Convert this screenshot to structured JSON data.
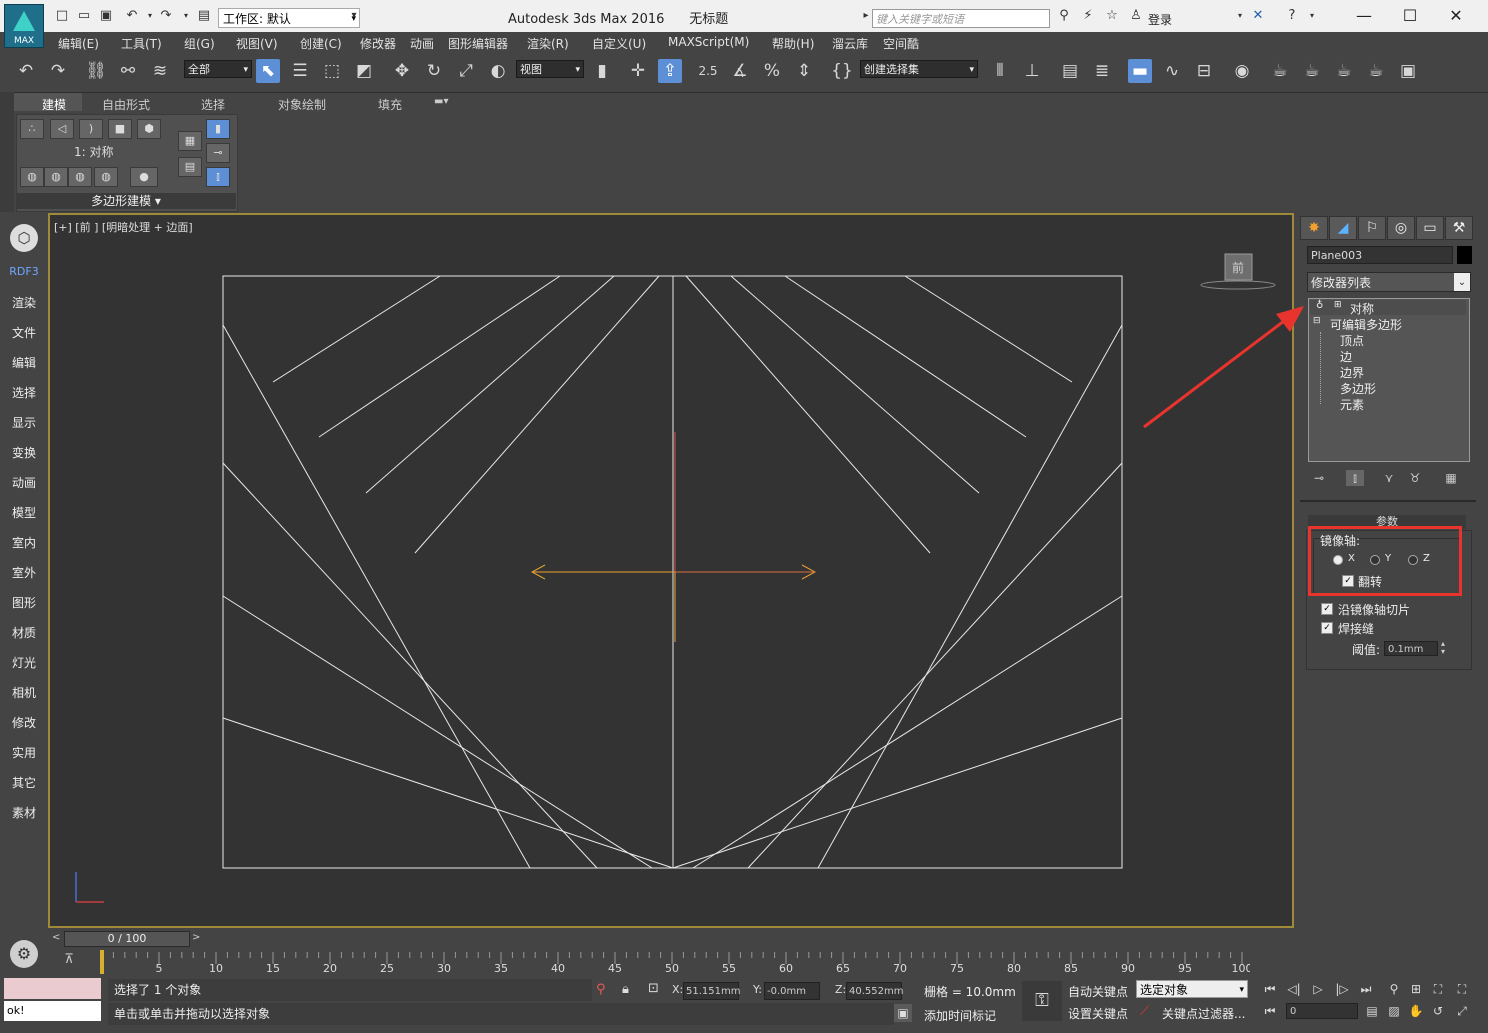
{
  "app": {
    "title": "Autodesk 3ds Max 2016",
    "document": "无标题",
    "logo_text": "MAX",
    "workspace_label": "工作区: 默认",
    "search_placeholder": "键入关键字或短语",
    "login": "登录"
  },
  "menu": [
    "编辑(E)",
    "工具(T)",
    "组(G)",
    "视图(V)",
    "创建(C)",
    "修改器",
    "动画",
    "图形编辑器",
    "渲染(R)",
    "自定义(U)",
    "MAXScript(M)",
    "帮助(H)",
    "溜云库",
    "空间酷"
  ],
  "toolbar": {
    "filter_value": "全部",
    "refcoord_value": "视图",
    "snap_label": "2.5",
    "named_selection_value": "创建选择集"
  },
  "ribbon": {
    "tabs": [
      "建模",
      "自由形式",
      "选择",
      "对象绘制",
      "填充"
    ],
    "stack_label": "1: 对称",
    "panel_label": "多边形建模"
  },
  "sidebar": {
    "top_label": "RDF3",
    "items": [
      "渲染",
      "文件",
      "编辑",
      "选择",
      "显示",
      "变换",
      "动画",
      "模型",
      "室内",
      "室外",
      "图形",
      "材质",
      "灯光",
      "相机",
      "修改",
      "实用",
      "其它",
      "素材"
    ]
  },
  "viewport": {
    "label": "[+] [前 ] [明暗处理 + 边面]",
    "viewcube_label": "前"
  },
  "command_panel": {
    "object_name": "Plane003",
    "modifier_list": "修改器列表",
    "stack": {
      "symmetry": "对称",
      "editpoly": "可编辑多边形",
      "sub": [
        "顶点",
        "边",
        "边界",
        "多边形",
        "元素"
      ]
    },
    "params_title": "参数",
    "mirror_axis_label": "镜像轴:",
    "axes": [
      "X",
      "Y",
      "Z"
    ],
    "axis_selected": "X",
    "flip_label": "翻转",
    "slice_label": "沿镜像轴切片",
    "weld_label": "焊接缝",
    "threshold_label": "阈值:",
    "threshold_value": "0.1mm"
  },
  "timeline": {
    "position": "0 / 100",
    "ticks": [
      "5",
      "10",
      "15",
      "20",
      "25",
      "30",
      "35",
      "40",
      "45",
      "50",
      "55",
      "60",
      "65",
      "70",
      "75",
      "80",
      "85",
      "90",
      "95",
      "100"
    ]
  },
  "status": {
    "maxscript_output": "ok!",
    "selected": "选择了 1 个对象",
    "prompt": "单击或单击并拖动以选择对象",
    "x_label": "X:",
    "x": "51.151mm",
    "y_label": "Y:",
    "y": "-0.0mm",
    "z_label": "Z:",
    "z": "40.552mm",
    "grid": "栅格 = 10.0mm",
    "add_time_tag": "添加时间标记",
    "auto_key": "自动关键点",
    "set_key": "设置关键点",
    "sel_filter": "选定对象",
    "key_filters": "关键点过滤器...",
    "frame": "0"
  }
}
